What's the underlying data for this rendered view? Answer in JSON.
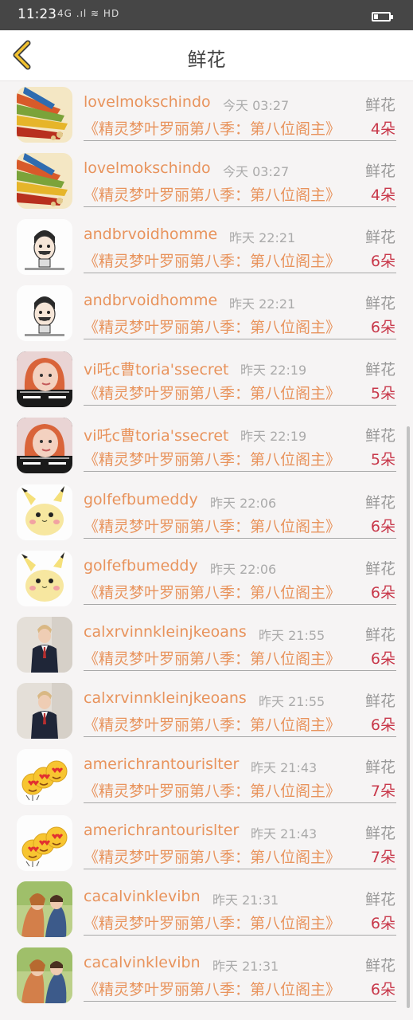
{
  "status": {
    "time": "11:23",
    "icons": "4G .ıl ≋ HD",
    "battery_level": 0.3
  },
  "header": {
    "title": "鲜花"
  },
  "list": {
    "items": [
      {
        "user": "lovelmokschindo",
        "time": "今天 03:27",
        "type": "鲜花",
        "book": "《精灵梦叶罗丽第八季：第八位阁主》",
        "count": "4朵",
        "avatar": "pencils"
      },
      {
        "user": "lovelmokschindo",
        "time": "今天 03:27",
        "type": "鲜花",
        "book": "《精灵梦叶罗丽第八季：第八位阁主》",
        "count": "4朵",
        "avatar": "pencils"
      },
      {
        "user": "andbrvoidhomme",
        "time": "昨天 22:21",
        "type": "鲜花",
        "book": "《精灵梦叶罗丽第八季：第八位阁主》",
        "count": "6朵",
        "avatar": "cartoon-man"
      },
      {
        "user": "andbrvoidhomme",
        "time": "昨天 22:21",
        "type": "鲜花",
        "book": "《精灵梦叶罗丽第八季：第八位阁主》",
        "count": "6朵",
        "avatar": "cartoon-man"
      },
      {
        "user": "vi吒c曹toria'ssecret",
        "time": "昨天 22:19",
        "type": "鲜花",
        "book": "《精灵梦叶罗丽第八季：第八位阁主》",
        "count": "5朵",
        "avatar": "girl"
      },
      {
        "user": "vi吒c曹toria'ssecret",
        "time": "昨天 22:19",
        "type": "鲜花",
        "book": "《精灵梦叶罗丽第八季：第八位阁主》",
        "count": "5朵",
        "avatar": "girl"
      },
      {
        "user": "golfefbumeddy",
        "time": "昨天 22:06",
        "type": "鲜花",
        "book": "《精灵梦叶罗丽第八季：第八位阁主》",
        "count": "6朵",
        "avatar": "pikachu"
      },
      {
        "user": "golfefbumeddy",
        "time": "昨天 22:06",
        "type": "鲜花",
        "book": "《精灵梦叶罗丽第八季：第八位阁主》",
        "count": "6朵",
        "avatar": "pikachu"
      },
      {
        "user": "calxrvinnkleinjkeoans",
        "time": "昨天 21:55",
        "type": "鲜花",
        "book": "《精灵梦叶罗丽第八季：第八位阁主》",
        "count": "6朵",
        "avatar": "man-suit"
      },
      {
        "user": "calxrvinnkleinjkeoans",
        "time": "昨天 21:55",
        "type": "鲜花",
        "book": "《精灵梦叶罗丽第八季：第八位阁主》",
        "count": "6朵",
        "avatar": "man-suit"
      },
      {
        "user": "americhrantourislter",
        "time": "昨天 21:43",
        "type": "鲜花",
        "book": "《精灵梦叶罗丽第八季：第八位阁主》",
        "count": "7朵",
        "avatar": "emoji-hearts"
      },
      {
        "user": "americhrantourislter",
        "time": "昨天 21:43",
        "type": "鲜花",
        "book": "《精灵梦叶罗丽第八季：第八位阁主》",
        "count": "7朵",
        "avatar": "emoji-hearts"
      },
      {
        "user": "cacalvinklevibn",
        "time": "昨天 21:31",
        "type": "鲜花",
        "book": "《精灵梦叶罗丽第八季：第八位阁主》",
        "count": "6朵",
        "avatar": "couple"
      },
      {
        "user": "cacalvinklevibn",
        "time": "昨天 21:31",
        "type": "鲜花",
        "book": "《精灵梦叶罗丽第八季：第八位阁主》",
        "count": "6朵",
        "avatar": "couple"
      }
    ]
  }
}
